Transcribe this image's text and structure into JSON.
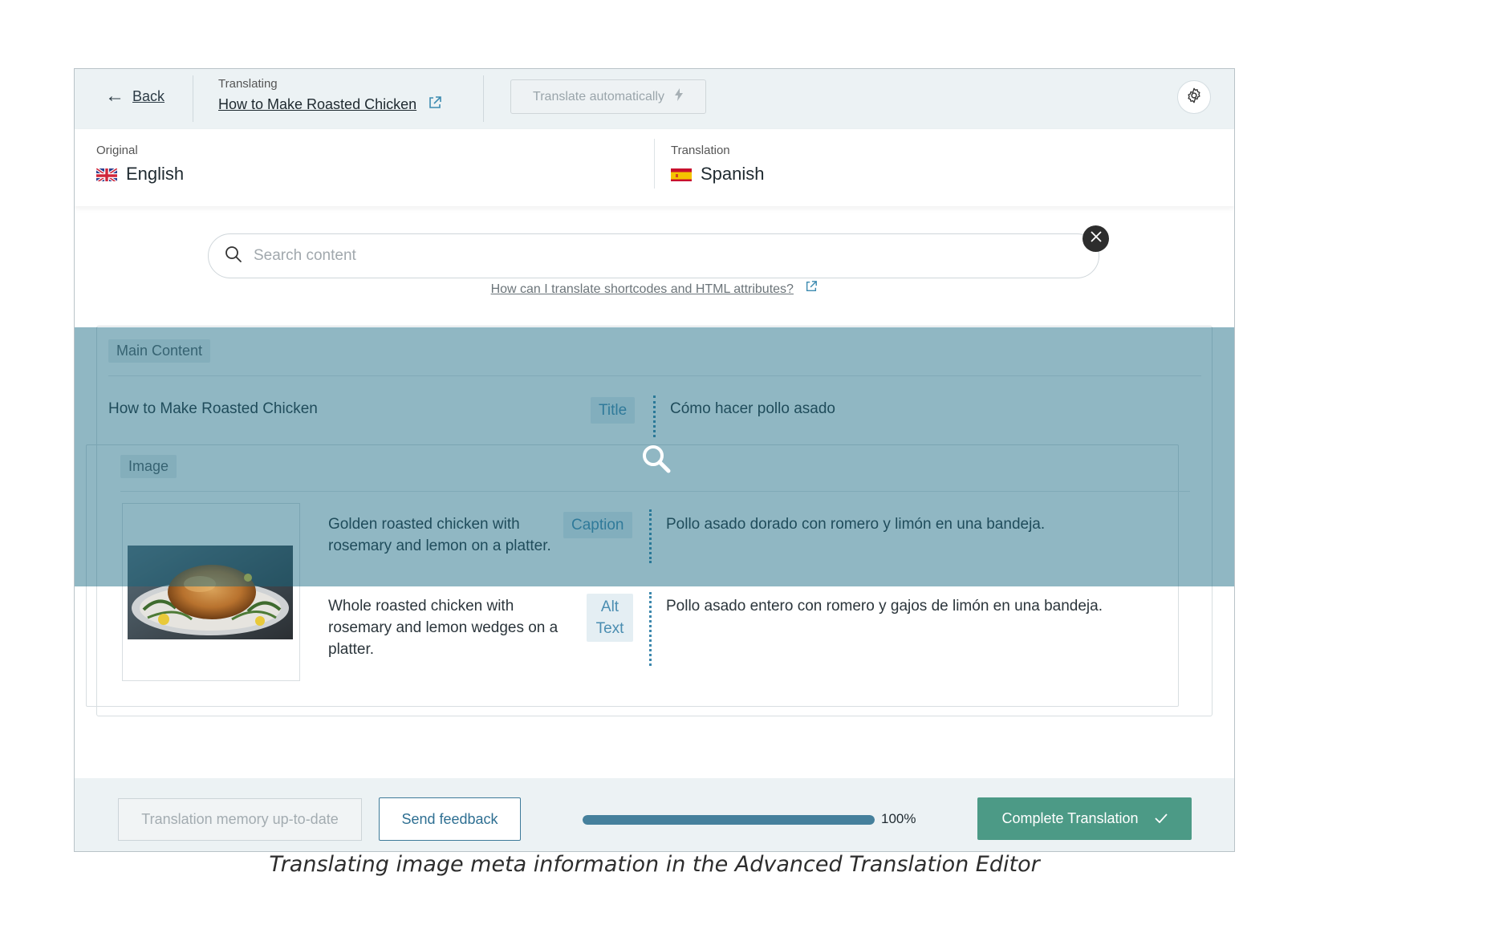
{
  "header": {
    "back_label": "Back",
    "translating_caption": "Translating",
    "document_title": "How to Make Roasted Chicken",
    "translate_auto_label": "Translate automatically"
  },
  "languages": {
    "original_caption": "Original",
    "original_name": "English",
    "translation_caption": "Translation",
    "translation_name": "Spanish"
  },
  "search": {
    "placeholder": "Search content",
    "help_link": "How can I translate shortcodes and HTML attributes?"
  },
  "main": {
    "section_label": "Main Content",
    "title_field": {
      "label": "Title",
      "original": "How to Make Roasted Chicken",
      "translation": "Cómo hacer pollo asado"
    },
    "image_section": {
      "label": "Image",
      "caption_field": {
        "label": "Caption",
        "original": "Golden roasted chicken with rosemary and lemon on a platter.",
        "translation": "Pollo asado dorado con romero y limón en una bandeja."
      },
      "alt_field": {
        "label": "Alt Text",
        "original": "Whole roasted chicken with rosemary and lemon wedges on a platter.",
        "translation": "Pollo asado entero con romero y gajos de limón en una bandeja."
      }
    }
  },
  "footer": {
    "memory_label": "Translation memory up-to-date",
    "feedback_label": "Send feedback",
    "progress_percent": 100,
    "progress_label": "100%",
    "complete_label": "Complete Translation"
  },
  "figure_caption": "Translating image meta information in the Advanced Translation Editor",
  "colors": {
    "accent_teal": "#4c9a86",
    "overlay": "#146580",
    "link_blue": "#3d88ad"
  }
}
